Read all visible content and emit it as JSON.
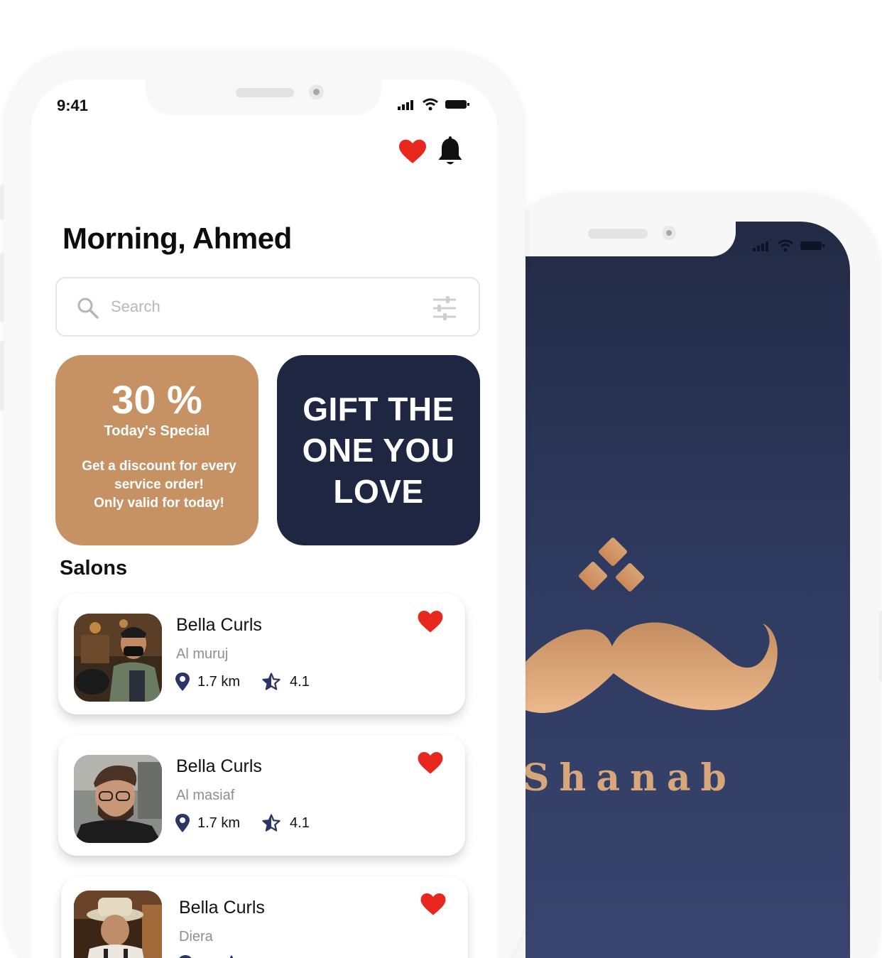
{
  "status_bar": {
    "time": "9:41"
  },
  "home": {
    "greeting": "Morning, Ahmed",
    "search": {
      "placeholder": "Search",
      "value": ""
    },
    "promo": {
      "percent": "30 %",
      "subtitle": "Today's Special",
      "description_line1": "Get a discount for every",
      "description_line2": "service order!",
      "description_line3": "Only valid for today!"
    },
    "gift": {
      "line1": "GIFT THE",
      "line2": "ONE YOU",
      "line3": "LOVE"
    },
    "salons_title": "Salons",
    "salons": [
      {
        "name": "Bella Curls",
        "area": "Al muruj",
        "distance": "1.7 km",
        "rating": "4.1"
      },
      {
        "name": "Bella Curls",
        "area": "Al masiaf",
        "distance": "1.7 km",
        "rating": "4.1"
      },
      {
        "name": "Bella Curls",
        "area": "Diera",
        "distance": "",
        "rating": ""
      }
    ]
  },
  "splash": {
    "brand": "Shanab"
  },
  "colors": {
    "accent_gold": "#c69263",
    "navy": "#1f2642",
    "heart_red": "#e8281e",
    "icon_navy": "#2b3566"
  },
  "icons": {
    "favorites": "heart-icon",
    "notifications": "bell-icon",
    "search": "search-icon",
    "filter": "sliders-icon",
    "location": "pin-icon",
    "rating": "star-icon"
  }
}
